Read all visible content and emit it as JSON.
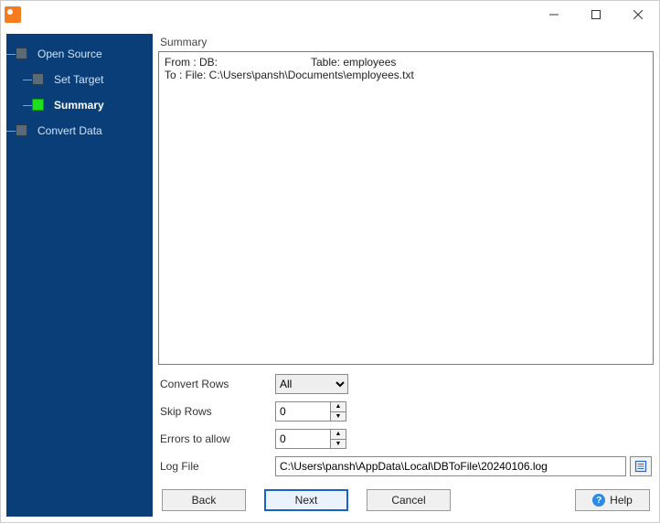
{
  "window": {
    "title": ""
  },
  "sidebar": {
    "items": [
      {
        "label": "Open Source",
        "child": false,
        "current": false
      },
      {
        "label": "Set Target",
        "child": true,
        "current": false
      },
      {
        "label": "Summary",
        "child": true,
        "current": true
      },
      {
        "label": "Convert Data",
        "child": false,
        "current": false
      }
    ]
  },
  "summary": {
    "heading": "Summary",
    "from_label": "From : DB:",
    "from_table": "Table: employees",
    "to_line": "To : File: C:\\Users\\pansh\\Documents\\employees.txt"
  },
  "controls": {
    "convert_rows": {
      "label": "Convert Rows",
      "value": "All",
      "options": [
        "All"
      ]
    },
    "skip_rows": {
      "label": "Skip Rows",
      "value": "0"
    },
    "errors": {
      "label": "Errors to allow",
      "value": "0"
    },
    "log_file": {
      "label": "Log File",
      "value": "C:\\Users\\pansh\\AppData\\Local\\DBToFile\\20240106.log"
    }
  },
  "buttons": {
    "back": "Back",
    "next": "Next",
    "cancel": "Cancel",
    "help": "Help"
  }
}
